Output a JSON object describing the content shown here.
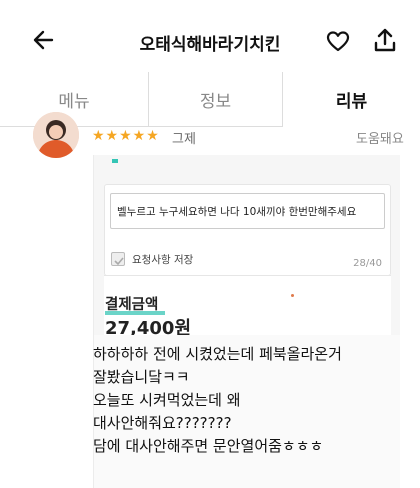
{
  "header": {
    "title": "오태식해바라기치킨",
    "back_icon": "arrow-left-icon",
    "favorite_icon": "heart-outline-icon",
    "share_icon": "share-icon"
  },
  "tabs": [
    {
      "label": "메뉴",
      "active": false
    },
    {
      "label": "정보",
      "active": false
    },
    {
      "label": "리뷰",
      "active": true
    }
  ],
  "review": {
    "stars": "★★★★★",
    "rating": 5,
    "author": "그제",
    "helpful_label": "도움돼요",
    "photo": {
      "request_text": "벨누르고 누구세요하면 나다 10새끼야 한번만해주세요",
      "save_label": "요청사항 저장",
      "char_count": "28/40",
      "payment_title": "결제금액",
      "payment_amount": "27,400원"
    },
    "text_lines": [
      "하하하하 전에 시켰었는데 페북올라온거",
      "잘봤습니닼ㅋㅋ",
      "오늘또 시켜먹었는데 왜",
      "대사안해줘요???????",
      "담에 대사안해주면 문안열어줌ㅎㅎㅎ"
    ]
  },
  "colors": {
    "star": "#f5a623",
    "accent": "#39c6b5"
  }
}
